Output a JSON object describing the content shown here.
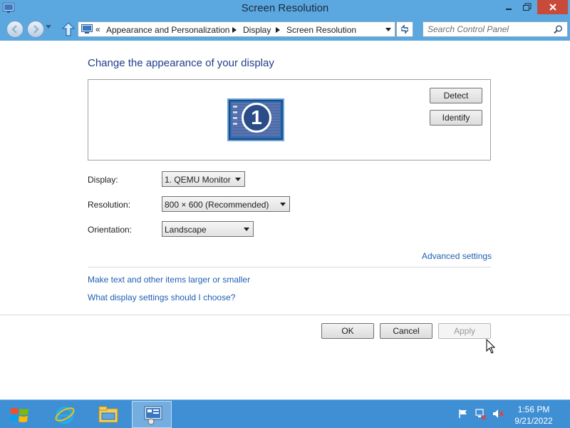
{
  "window": {
    "title": "Screen Resolution"
  },
  "navbar": {
    "breadcrumb_prefix": "«",
    "breadcrumbs": [
      "Appearance and Personalization",
      "Display",
      "Screen Resolution"
    ],
    "search_placeholder": "Search Control Panel"
  },
  "page": {
    "heading": "Change the appearance of your display",
    "monitor_number": "1",
    "detect_label": "Detect",
    "identify_label": "Identify",
    "display_label": "Display:",
    "display_value": "1. QEMU Monitor",
    "resolution_label": "Resolution:",
    "resolution_value": "800 × 600 (Recommended)",
    "orientation_label": "Orientation:",
    "orientation_value": "Landscape",
    "advanced_link": "Advanced settings",
    "text_size_link": "Make text and other items larger or smaller",
    "help_link": "What display settings should I choose?",
    "ok_label": "OK",
    "cancel_label": "Cancel",
    "apply_label": "Apply"
  },
  "taskbar": {
    "items": [
      "internet-explorer-icon",
      "file-explorer-icon",
      "control-panel-icon"
    ],
    "tray_icons": [
      "action-center-flag-icon",
      "network-icon",
      "volume-muted-icon"
    ],
    "time": "1:56 PM",
    "date": "9/21/2022"
  },
  "colors": {
    "titlebar": "#5ba8e0",
    "close_button": "#c74a3b",
    "taskbar": "#3f8fd4",
    "heading": "#1e3f8a",
    "link": "#1e5fb4"
  }
}
